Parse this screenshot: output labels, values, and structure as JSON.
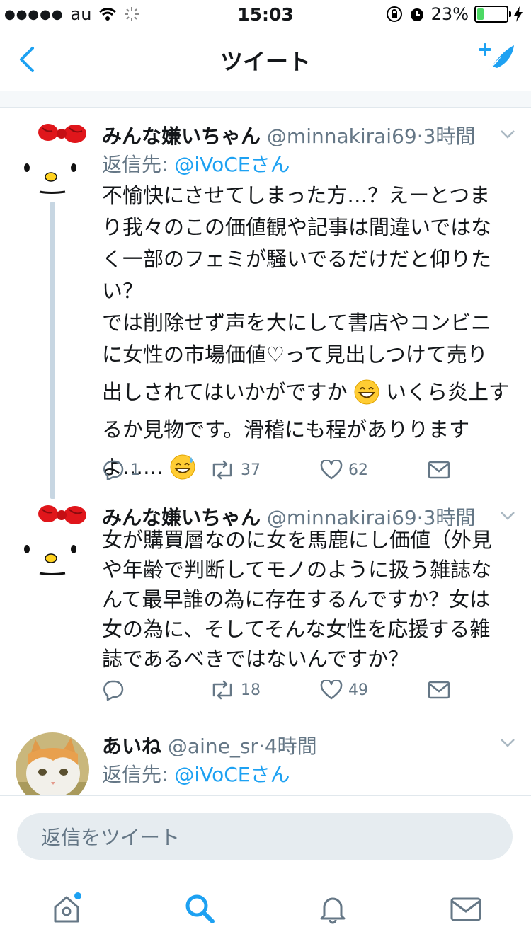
{
  "status_bar": {
    "carrier": "au",
    "time": "15:03",
    "battery": "23%",
    "battery_level": 0.23
  },
  "nav": {
    "title": "ツイート",
    "back_icon": "chevron-left-icon",
    "compose_icon": "compose-tweet-icon"
  },
  "colors": {
    "accent": "#1da1f2",
    "secondary_text": "#657786",
    "thread_line": "#c7d6e2"
  },
  "tweets": [
    {
      "name": "みんな嫌いちゃん",
      "handle": "@minnakirai69",
      "time": "3時間",
      "reply_prefix": "返信先: ",
      "reply_to": "@iVoCEさん",
      "body_lines": [
        "不愉快にさせてしまった方…？えーとつま",
        "り我々のこの価値観や記事は間違いではな",
        "く一部のフェミが騒いでるだけだと仰りた",
        "い？",
        "では削除せず声を大にして書店やコンビニ",
        "に女性の市場価値♡って見出しつけて売り",
        "出しされてはいかがですか",
        "いくら炎上す",
        "るか見物です。滑稽にも程がありります",
        "よ……"
      ],
      "replies": "1",
      "retweets": "37",
      "likes": "62"
    },
    {
      "name": "みんな嫌いちゃん",
      "handle": "@minnakirai69",
      "time": "3時間",
      "body_lines": [
        "女が購買層なのに女を馬鹿にし価値（外見",
        "や年齢で判断してモノのように扱う雑誌な",
        "んて最早誰の為に存在するんですか？女は",
        "女の為に、そしてそんな女性を応援する雑",
        "誌であるべきではないんですか？"
      ],
      "replies": "",
      "retweets": "18",
      "likes": "49"
    },
    {
      "name": "あいね",
      "handle": "@aine_sr",
      "time": "4時間",
      "reply_prefix": "返信先: ",
      "reply_to": "@iVoCEさん"
    }
  ],
  "reply_bar": {
    "placeholder": "返信をツイート"
  },
  "tabs": [
    {
      "icon": "home-icon",
      "active": false,
      "has_badge": true
    },
    {
      "icon": "search-icon",
      "active": true
    },
    {
      "icon": "notifications-bell-icon",
      "active": false
    },
    {
      "icon": "messages-envelope-icon",
      "active": false
    }
  ]
}
